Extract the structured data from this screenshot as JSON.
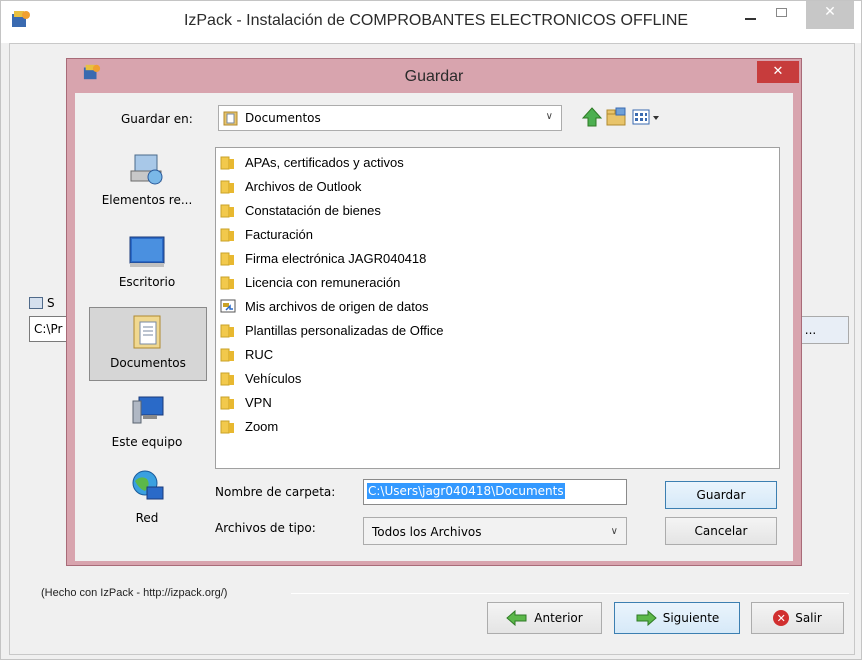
{
  "outer": {
    "title": "IzPack - Instalación de  COMPROBANTES ELECTRONICOS OFFLINE",
    "close_glyph": "✕",
    "bg_label": "S",
    "bg_path": "C:\\Pr",
    "bg_browse": "r ...",
    "made_with": "(Hecho con IzPack - http://izpack.org/)",
    "buttons": {
      "previous": "Anterior",
      "next": "Siguiente",
      "exit": "Salir"
    }
  },
  "dialog": {
    "title": "Guardar",
    "close_glyph": "✕",
    "save_in_label": "Guardar en:",
    "save_in_value": "Documentos",
    "places": [
      {
        "label": "Elementos re...",
        "icon": "recent-items-icon"
      },
      {
        "label": "Escritorio",
        "icon": "desktop-icon"
      },
      {
        "label": "Documentos",
        "icon": "documents-icon"
      },
      {
        "label": "Este equipo",
        "icon": "computer-icon"
      },
      {
        "label": "Red",
        "icon": "network-icon"
      }
    ],
    "files": [
      "APAs, certificados y activos",
      "Archivos de Outlook",
      "Constatación de bienes",
      "Facturación",
      "Firma electrónica JAGR040418",
      "Licencia con remuneración",
      "Mis archivos de origen de datos",
      "Plantillas personalizadas de Office",
      "RUC",
      "Vehículos",
      "VPN",
      "Zoom"
    ],
    "folder_name_label": "Nombre de carpeta:",
    "folder_name_value": "C:\\Users\\jagr040418\\Documents",
    "file_type_label": "Archivos de tipo:",
    "file_type_value": "Todos los Archivos",
    "save_button": "Guardar",
    "cancel_button": "Cancelar"
  },
  "colors": {
    "dialog_frame": "#d8a4ae",
    "selection": "#3399ff",
    "close_red": "#c73c3c"
  }
}
